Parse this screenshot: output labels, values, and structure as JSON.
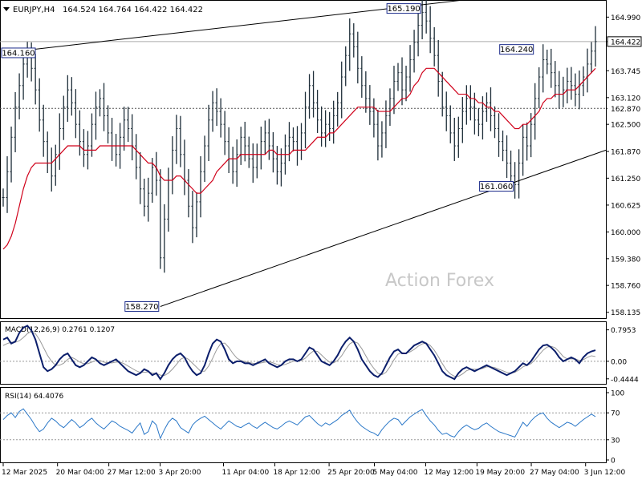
{
  "header": {
    "symbol_tf": "EURJPY,H4",
    "ohlc": "164.524 164.764 164.422 164.422"
  },
  "watermark": "Action Forex",
  "colors": {
    "price": "#1f2f3a",
    "ma": "#d0021b",
    "macd_main": "#0b1e6b",
    "macd_signal": "#9a9a9a",
    "rsi": "#2b78c8",
    "label_border": "#1a2a8a",
    "watermark": "#c8c8c8"
  },
  "chart_data": [
    {
      "type": "line",
      "panel": "price",
      "ylim": [
        158.0,
        165.35
      ],
      "ytick_labels": [
        "164.990",
        "164.422",
        "163.745",
        "163.120",
        "162.870",
        "162.500",
        "161.870",
        "161.250",
        "160.625",
        "160.000",
        "159.380",
        "158.760",
        "158.135"
      ],
      "ytick_values": [
        164.99,
        164.422,
        163.745,
        163.12,
        162.87,
        162.5,
        161.87,
        161.25,
        160.625,
        160.0,
        159.38,
        158.76,
        158.135
      ],
      "horizontal_levels": [
        {
          "value": 164.422,
          "label": "164.422",
          "style": "solid",
          "highlight": true
        },
        {
          "value": 162.87,
          "label": "162.870",
          "style": "dashed",
          "highlight": false
        }
      ],
      "x_count": 148,
      "xtick_labels": [
        "12 Mar 2025",
        "20 Mar 04:00",
        "27 Mar 12:00",
        "3 Apr 20:00",
        "11 Apr 04:00",
        "18 Apr 12:00",
        "25 Apr 20:00",
        "5 May 04:00",
        "12 May 12:00",
        "19 May 20:00",
        "27 May 04:00",
        "3 Jun 12:00"
      ],
      "xtick_index": [
        0,
        18,
        35,
        52,
        73,
        90,
        108,
        123,
        140,
        157,
        175,
        193
      ],
      "price_series": [
        160.8,
        161.4,
        162.2,
        162.9,
        163.4,
        163.9,
        164.1,
        163.8,
        163.3,
        162.6,
        162.1,
        161.6,
        161.3,
        161.8,
        162.4,
        162.9,
        163.3,
        163.0,
        162.5,
        162.1,
        161.8,
        162.0,
        162.5,
        162.9,
        163.1,
        162.7,
        162.3,
        162.0,
        161.8,
        162.2,
        162.6,
        162.4,
        162.0,
        161.5,
        161.0,
        160.6,
        160.9,
        161.5,
        161.2,
        159.4,
        160.3,
        161.2,
        161.9,
        162.4,
        161.8,
        161.2,
        160.6,
        160.1,
        160.7,
        161.4,
        162.0,
        162.6,
        163.0,
        162.8,
        162.5,
        162.1,
        161.7,
        161.4,
        161.8,
        162.2,
        162.0,
        161.7,
        161.5,
        161.8,
        162.1,
        162.3,
        162.0,
        161.7,
        161.4,
        161.6,
        162.0,
        162.2,
        162.1,
        161.9,
        162.3,
        162.9,
        163.4,
        163.0,
        162.6,
        162.3,
        162.5,
        162.4,
        162.7,
        163.0,
        163.6,
        164.1,
        164.6,
        164.3,
        163.8,
        163.4,
        163.1,
        162.8,
        162.5,
        162.0,
        162.3,
        162.7,
        163.1,
        163.5,
        163.7,
        163.3,
        163.6,
        164.0,
        164.4,
        164.8,
        165.1,
        164.9,
        164.5,
        164.1,
        163.5,
        162.9,
        162.7,
        162.3,
        162.0,
        162.4,
        162.8,
        163.1,
        162.9,
        162.6,
        162.5,
        162.8,
        163.0,
        162.7,
        162.4,
        162.1,
        161.9,
        161.6,
        161.3,
        161.1,
        161.6,
        162.2,
        162.0,
        162.5,
        163.1,
        163.6,
        164.0,
        163.9,
        163.7,
        163.4,
        163.2,
        163.3,
        163.5,
        163.4,
        163.2,
        163.4,
        163.6,
        163.9,
        164.2,
        164.422
      ],
      "ma_series": [
        159.6,
        159.7,
        159.9,
        160.2,
        160.6,
        161.0,
        161.3,
        161.5,
        161.6,
        161.6,
        161.6,
        161.6,
        161.6,
        161.7,
        161.8,
        161.9,
        162.0,
        162.0,
        162.0,
        162.0,
        161.9,
        161.9,
        161.9,
        161.9,
        162.0,
        162.0,
        162.0,
        162.0,
        162.0,
        162.0,
        162.0,
        162.0,
        162.0,
        161.9,
        161.8,
        161.7,
        161.6,
        161.6,
        161.5,
        161.3,
        161.2,
        161.2,
        161.2,
        161.3,
        161.3,
        161.2,
        161.1,
        161.0,
        160.9,
        160.9,
        161.0,
        161.1,
        161.2,
        161.4,
        161.5,
        161.6,
        161.7,
        161.7,
        161.7,
        161.8,
        161.8,
        161.8,
        161.8,
        161.8,
        161.8,
        161.8,
        161.9,
        161.9,
        161.8,
        161.8,
        161.8,
        161.8,
        161.9,
        161.9,
        161.9,
        161.9,
        162.0,
        162.1,
        162.2,
        162.2,
        162.2,
        162.3,
        162.3,
        162.4,
        162.5,
        162.6,
        162.7,
        162.8,
        162.9,
        162.9,
        162.9,
        162.9,
        162.9,
        162.8,
        162.8,
        162.8,
        162.8,
        162.9,
        163.0,
        163.1,
        163.1,
        163.2,
        163.4,
        163.5,
        163.7,
        163.8,
        163.8,
        163.8,
        163.7,
        163.6,
        163.5,
        163.4,
        163.3,
        163.2,
        163.2,
        163.2,
        163.1,
        163.1,
        163.0,
        163.0,
        162.9,
        162.9,
        162.8,
        162.8,
        162.7,
        162.6,
        162.5,
        162.4,
        162.4,
        162.5,
        162.5,
        162.6,
        162.7,
        162.8,
        163.0,
        163.1,
        163.1,
        163.2,
        163.2,
        163.2,
        163.3,
        163.3,
        163.3,
        163.4,
        163.5,
        163.6,
        163.7,
        163.8
      ],
      "annotations": [
        {
          "text": "164.160",
          "x_index": 4,
          "value": 164.16
        },
        {
          "text": "158.270",
          "x_index": 39,
          "value": 158.27
        },
        {
          "text": "165.190",
          "x_index": 104,
          "value": 165.19
        },
        {
          "text": "164.240",
          "x_index": 132,
          "value": 164.24
        },
        {
          "text": "161.060",
          "x_index": 127,
          "value": 161.06
        }
      ],
      "trendlines": [
        {
          "from": {
            "x_index": 0,
            "value": 164.16
          },
          "to": {
            "x_index": 148,
            "value": 165.75
          }
        },
        {
          "from": {
            "x_index": 39,
            "value": 158.27
          },
          "to": {
            "x_index": 160,
            "value": 161.9
          }
        }
      ]
    },
    {
      "type": "line",
      "panel": "macd",
      "title": "MACD(12,26,9) 0.2761 0.1207",
      "ytick_labels": [
        "0.7953",
        "0.00",
        "-0.4444"
      ],
      "ytick_values": [
        0.7953,
        0.0,
        -0.4444
      ],
      "ylim": [
        -0.55,
        0.95
      ],
      "series": [
        {
          "name": "main",
          "values": [
            0.55,
            0.6,
            0.45,
            0.5,
            0.72,
            0.85,
            0.9,
            0.78,
            0.55,
            0.2,
            -0.15,
            -0.25,
            -0.2,
            -0.1,
            0.05,
            0.15,
            0.2,
            0.05,
            -0.1,
            -0.15,
            -0.1,
            0.0,
            0.1,
            0.05,
            -0.05,
            -0.1,
            -0.05,
            0.0,
            0.05,
            -0.05,
            -0.15,
            -0.25,
            -0.3,
            -0.35,
            -0.3,
            -0.2,
            -0.25,
            -0.35,
            -0.3,
            -0.45,
            -0.3,
            -0.1,
            0.05,
            0.15,
            0.2,
            0.1,
            -0.1,
            -0.25,
            -0.35,
            -0.3,
            -0.1,
            0.2,
            0.45,
            0.55,
            0.5,
            0.3,
            0.05,
            -0.05,
            0.0,
            0.0,
            -0.05,
            -0.05,
            -0.1,
            -0.05,
            0.0,
            0.05,
            -0.05,
            -0.1,
            -0.15,
            -0.1,
            0.0,
            0.05,
            0.05,
            0.0,
            0.05,
            0.2,
            0.35,
            0.3,
            0.15,
            0.0,
            -0.05,
            -0.1,
            0.0,
            0.15,
            0.35,
            0.5,
            0.6,
            0.5,
            0.3,
            0.05,
            -0.1,
            -0.25,
            -0.35,
            -0.4,
            -0.3,
            -0.1,
            0.1,
            0.25,
            0.3,
            0.2,
            0.2,
            0.3,
            0.4,
            0.45,
            0.5,
            0.45,
            0.3,
            0.15,
            -0.05,
            -0.25,
            -0.35,
            -0.4,
            -0.45,
            -0.3,
            -0.2,
            -0.15,
            -0.2,
            -0.25,
            -0.2,
            -0.15,
            -0.1,
            -0.15,
            -0.2,
            -0.25,
            -0.3,
            -0.35,
            -0.3,
            -0.25,
            -0.15,
            -0.05,
            -0.1,
            0.0,
            0.15,
            0.3,
            0.4,
            0.42,
            0.35,
            0.25,
            0.1,
            0.0,
            0.05,
            0.1,
            0.05,
            -0.05,
            0.1,
            0.2,
            0.25,
            0.28
          ]
        },
        {
          "name": "signal",
          "values": [
            0.4,
            0.45,
            0.48,
            0.48,
            0.52,
            0.6,
            0.7,
            0.75,
            0.7,
            0.55,
            0.35,
            0.15,
            0.0,
            -0.1,
            -0.1,
            -0.05,
            0.05,
            0.1,
            0.05,
            -0.02,
            -0.06,
            -0.06,
            -0.02,
            0.02,
            0.02,
            -0.02,
            -0.04,
            -0.04,
            -0.02,
            -0.02,
            -0.06,
            -0.12,
            -0.18,
            -0.24,
            -0.28,
            -0.28,
            -0.27,
            -0.3,
            -0.31,
            -0.35,
            -0.36,
            -0.3,
            -0.2,
            -0.08,
            0.05,
            0.1,
            0.05,
            -0.05,
            -0.15,
            -0.25,
            -0.25,
            -0.12,
            0.08,
            0.3,
            0.45,
            0.46,
            0.35,
            0.2,
            0.08,
            0.02,
            -0.01,
            -0.03,
            -0.05,
            -0.06,
            -0.04,
            -0.02,
            -0.01,
            -0.04,
            -0.08,
            -0.1,
            -0.08,
            -0.04,
            0.0,
            0.01,
            0.02,
            0.08,
            0.18,
            0.26,
            0.25,
            0.16,
            0.06,
            -0.02,
            -0.04,
            0.02,
            0.14,
            0.3,
            0.44,
            0.5,
            0.46,
            0.32,
            0.14,
            -0.04,
            -0.18,
            -0.3,
            -0.34,
            -0.28,
            -0.14,
            0.04,
            0.18,
            0.22,
            0.2,
            0.24,
            0.3,
            0.38,
            0.44,
            0.46,
            0.4,
            0.28,
            0.12,
            -0.06,
            -0.22,
            -0.32,
            -0.38,
            -0.38,
            -0.32,
            -0.24,
            -0.2,
            -0.2,
            -0.2,
            -0.18,
            -0.14,
            -0.14,
            -0.16,
            -0.2,
            -0.24,
            -0.28,
            -0.3,
            -0.28,
            -0.22,
            -0.14,
            -0.1,
            -0.06,
            0.04,
            0.16,
            0.28,
            0.36,
            0.38,
            0.34,
            0.24,
            0.12,
            0.06,
            0.06,
            0.06,
            0.02,
            0.04,
            0.1,
            0.14,
            0.12
          ]
        }
      ]
    },
    {
      "type": "line",
      "panel": "rsi",
      "title": "RSI(14) 64.4076",
      "ytick_labels": [
        "100",
        "70",
        "30",
        "0"
      ],
      "ytick_values": [
        100,
        70,
        30,
        0
      ],
      "ylim": [
        0,
        100
      ],
      "levels": [
        70,
        30
      ],
      "values": [
        60,
        66,
        70,
        63,
        72,
        76,
        68,
        60,
        50,
        42,
        46,
        55,
        62,
        58,
        52,
        48,
        54,
        60,
        55,
        48,
        52,
        58,
        62,
        55,
        50,
        46,
        52,
        58,
        55,
        50,
        47,
        44,
        40,
        48,
        55,
        38,
        42,
        58,
        52,
        32,
        45,
        56,
        62,
        58,
        48,
        44,
        40,
        52,
        58,
        62,
        65,
        60,
        55,
        50,
        46,
        52,
        58,
        54,
        50,
        48,
        52,
        55,
        50,
        47,
        52,
        56,
        52,
        48,
        46,
        50,
        55,
        58,
        55,
        52,
        58,
        64,
        66,
        60,
        54,
        50,
        55,
        52,
        56,
        60,
        66,
        70,
        74,
        64,
        56,
        50,
        46,
        42,
        40,
        36,
        45,
        52,
        58,
        62,
        60,
        52,
        58,
        64,
        68,
        72,
        75,
        66,
        58,
        52,
        44,
        38,
        40,
        36,
        34,
        42,
        48,
        52,
        48,
        45,
        47,
        52,
        55,
        50,
        46,
        42,
        40,
        38,
        36,
        34,
        45,
        56,
        50,
        58,
        64,
        68,
        70,
        62,
        56,
        52,
        48,
        52,
        56,
        54,
        50,
        55,
        60,
        64,
        68,
        64.4
      ]
    }
  ]
}
